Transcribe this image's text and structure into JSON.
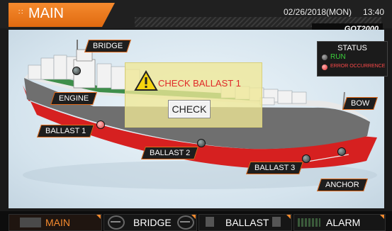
{
  "header": {
    "title": "MAIN",
    "title_glyph": "∷",
    "date": "02/26/2018(MON)",
    "time": "13:40",
    "brand": "GOT2000"
  },
  "status": {
    "title": "STATUS",
    "run_label": "RUN",
    "error_label": "ERROR OCCURRENCE",
    "colors": {
      "run": "#3ccf3c",
      "error": "#ff4a4a"
    }
  },
  "labels": {
    "bridge": "BRIDGE",
    "engine": "ENGINE",
    "bow": "BOW",
    "ballast1": "BALLAST 1",
    "ballast2": "BALLAST 2",
    "ballast3": "BALLAST 3",
    "anchor": "ANCHOR"
  },
  "alert": {
    "message": "CHECK BALLAST 1",
    "button_label": "CHECK",
    "icon": "warning-icon"
  },
  "nav": {
    "tabs": [
      {
        "label": "MAIN",
        "active": true
      },
      {
        "label": "BRIDGE",
        "active": false
      },
      {
        "label": "BALLAST",
        "active": false
      },
      {
        "label": "ALARM",
        "active": false
      }
    ]
  },
  "colors": {
    "accent": "#f58a2e",
    "hull_bottom": "#d62020",
    "hull_top": "#e8e8e8"
  }
}
